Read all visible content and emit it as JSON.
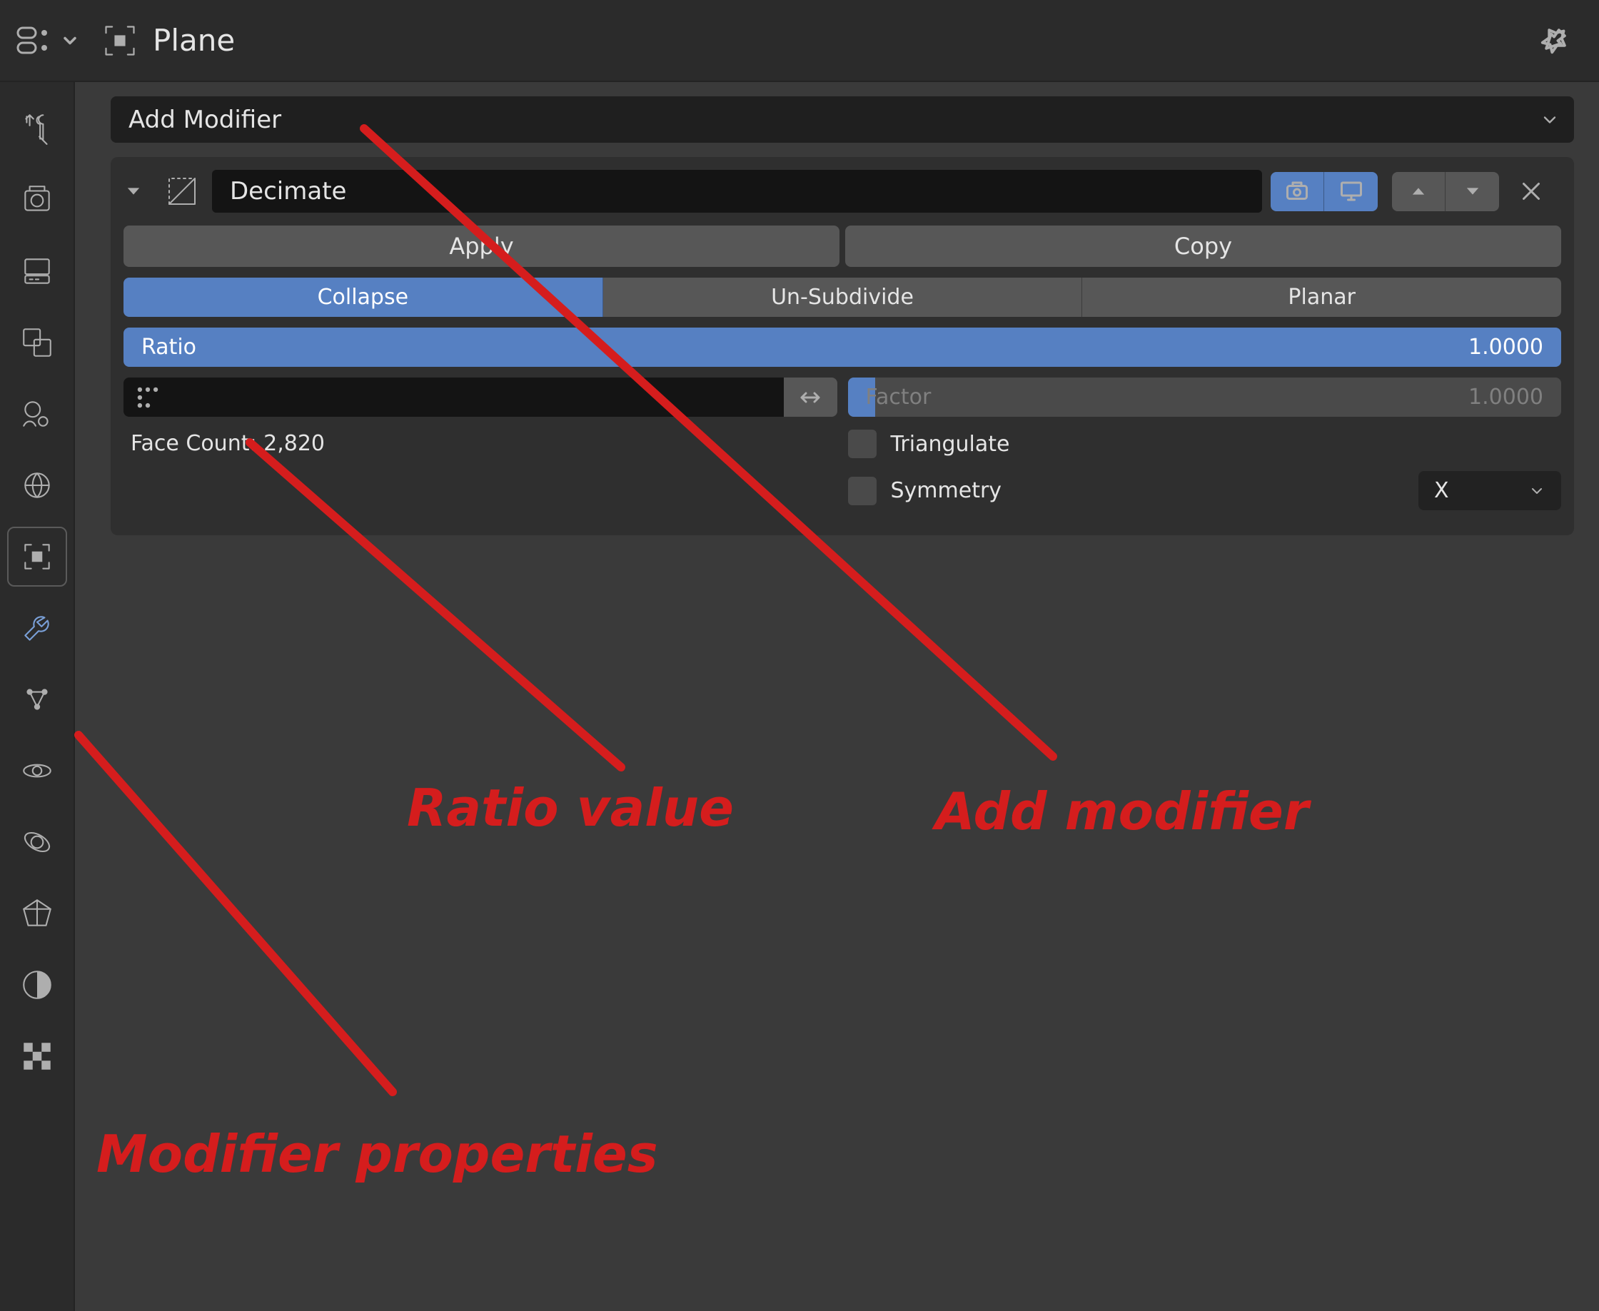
{
  "header": {
    "object_name": "Plane"
  },
  "tabs": {
    "items": [
      "tool",
      "render",
      "output",
      "view-layer",
      "scene",
      "world",
      "object",
      "modifiers",
      "particles",
      "physics",
      "constraints",
      "mesh-data",
      "material",
      "texture"
    ],
    "active_index": 7
  },
  "add_modifier_label": "Add Modifier",
  "modifier": {
    "name": "Decimate",
    "apply_label": "Apply",
    "copy_label": "Copy",
    "modes": {
      "collapse": "Collapse",
      "unsubdivide": "Un-Subdivide",
      "planar": "Planar"
    },
    "mode_active": "collapse",
    "ratio_label": "Ratio",
    "ratio_value": "1.0000",
    "factor_label": "Factor",
    "factor_value": "1.0000",
    "face_count_label": "Face Count: 2,820",
    "triangulate_label": "Triangulate",
    "symmetry_label": "Symmetry",
    "symmetry_axis": "X"
  },
  "annotations": {
    "ratio": "Ratio value",
    "add_modifier": "Add modifier",
    "modifier_props": "Modifier properties"
  }
}
